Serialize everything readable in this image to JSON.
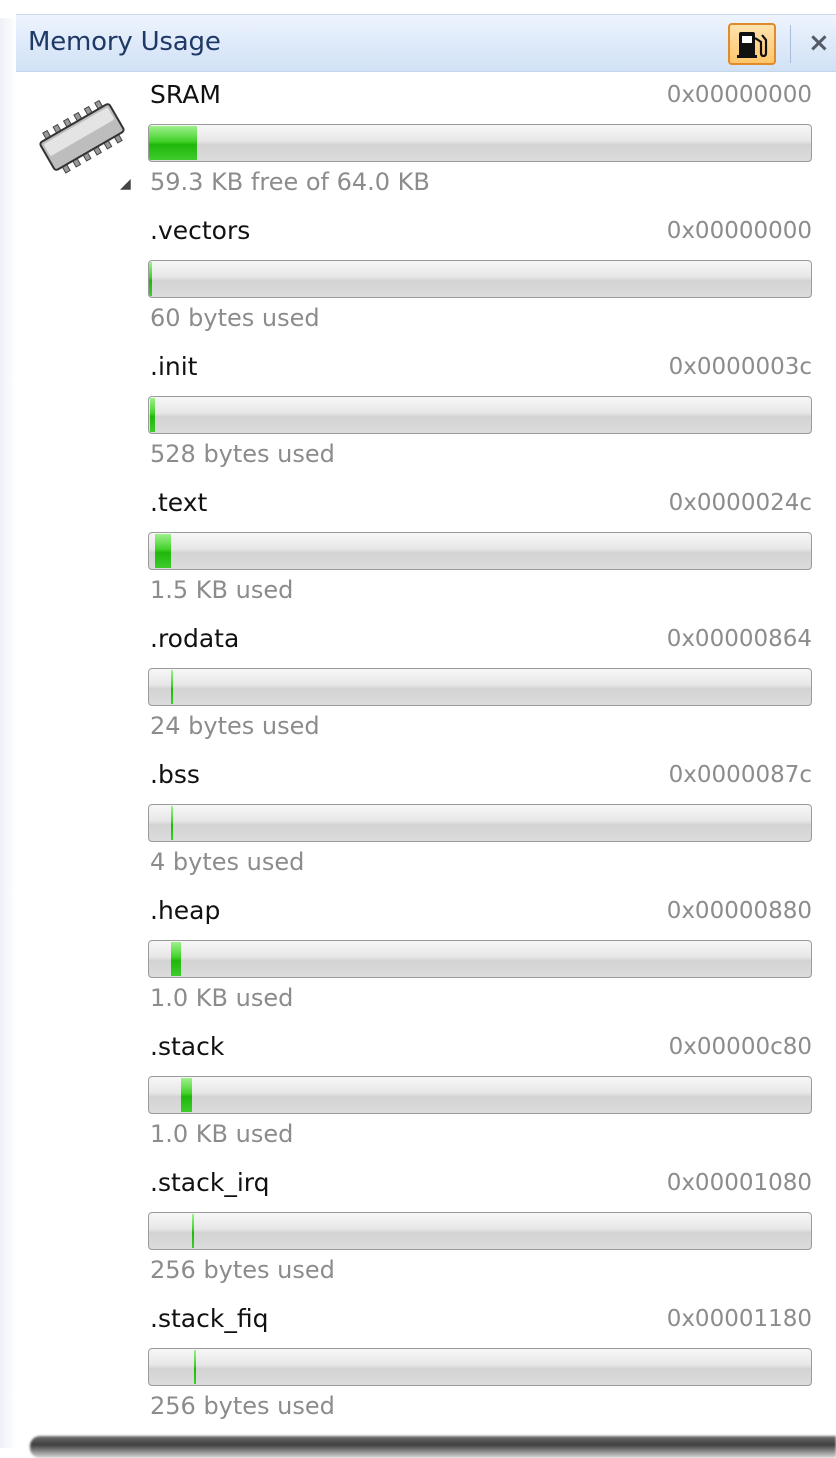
{
  "window": {
    "title": "Memory Usage"
  },
  "icons": {
    "fuel_button": "fuel-pump-icon",
    "close": "close-icon",
    "chip": "memory-chip-icon"
  },
  "colors": {
    "accent_fill": "#2bbf15",
    "title_text": "#1e3966",
    "fuel_border": "#e08a2a"
  },
  "close_label": "×",
  "collapse_glyph": "◢",
  "regions": [
    {
      "name": "SRAM",
      "address": "0x00000000",
      "usage": "59.3 KB free of 64.0 KB",
      "fill_start_pct": 0,
      "fill_end_pct": 7.3
    },
    {
      "name": ".vectors",
      "address": "0x00000000",
      "usage": "60 bytes used",
      "fill_start_pct": 0,
      "fill_end_pct": 0.4
    },
    {
      "name": ".init",
      "address": "0x0000003c",
      "usage": "528 bytes used",
      "fill_start_pct": 0.1,
      "fill_end_pct": 0.9
    },
    {
      "name": ".text",
      "address": "0x0000024c",
      "usage": "1.5 KB used",
      "fill_start_pct": 0.9,
      "fill_end_pct": 3.3
    },
    {
      "name": ".rodata",
      "address": "0x00000864",
      "usage": "24 bytes used",
      "fill_start_pct": 3.3,
      "fill_end_pct": 3.6
    },
    {
      "name": ".bss",
      "address": "0x0000087c",
      "usage": "4 bytes used",
      "fill_start_pct": 3.3,
      "fill_end_pct": 3.6
    },
    {
      "name": ".heap",
      "address": "0x00000880",
      "usage": "1.0 KB used",
      "fill_start_pct": 3.3,
      "fill_end_pct": 4.9
    },
    {
      "name": ".stack",
      "address": "0x00000c80",
      "usage": "1.0 KB used",
      "fill_start_pct": 4.9,
      "fill_end_pct": 6.5
    },
    {
      "name": ".stack_irq",
      "address": "0x00001080",
      "usage": "256 bytes used",
      "fill_start_pct": 6.5,
      "fill_end_pct": 6.8
    },
    {
      "name": ".stack_fiq",
      "address": "0x00001180",
      "usage": "256 bytes used",
      "fill_start_pct": 6.8,
      "fill_end_pct": 7.1
    }
  ]
}
